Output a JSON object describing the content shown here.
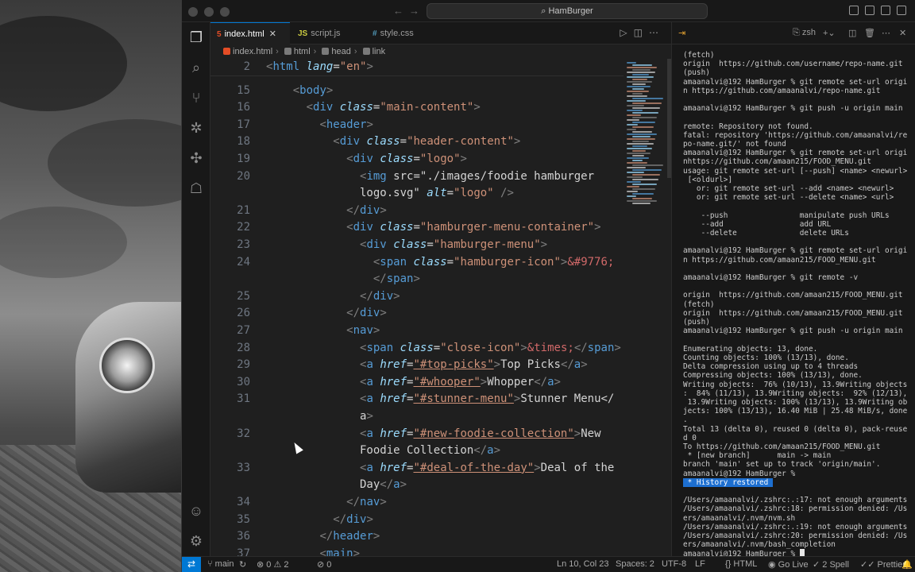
{
  "app": {
    "search_label": "HamBurger"
  },
  "tabs": [
    {
      "label": "index.html",
      "icon": "html-file-icon",
      "active": true
    },
    {
      "label": "script.js",
      "icon": "js-file-icon",
      "active": false
    },
    {
      "label": "style.css",
      "icon": "css-file-icon",
      "active": false
    }
  ],
  "breadcrumb": [
    "index.html",
    "html",
    "head",
    "link"
  ],
  "code": {
    "sticky_line": {
      "num": "2",
      "text": "<html lang=\"en\">"
    },
    "lines": [
      {
        "num": "15",
        "text": "    <body>"
      },
      {
        "num": "16",
        "text": "      <div class=\"main-content\">"
      },
      {
        "num": "17",
        "text": "        <header>"
      },
      {
        "num": "18",
        "text": "          <div class=\"header-content\">"
      },
      {
        "num": "19",
        "text": "            <div class=\"logo\">"
      },
      {
        "num": "20",
        "text": "              <img src=\"./images/foodie hamburger"
      },
      {
        "num": "",
        "text": "              logo.svg\" alt=\"logo\" />"
      },
      {
        "num": "21",
        "text": "            </div>"
      },
      {
        "num": "22",
        "text": "            <div class=\"hamburger-menu-container\">"
      },
      {
        "num": "23",
        "text": "              <div class=\"hamburger-menu\">"
      },
      {
        "num": "24",
        "text": "                <span class=\"hamburger-icon\">&#9776;"
      },
      {
        "num": "",
        "text": "                </span>"
      },
      {
        "num": "25",
        "text": "              </div>"
      },
      {
        "num": "26",
        "text": "            </div>"
      },
      {
        "num": "27",
        "text": "            <nav>"
      },
      {
        "num": "28",
        "text": "              <span class=\"close-icon\">&times;</span>"
      },
      {
        "num": "29",
        "text": "              <a href=\"#top-picks\">Top Picks</a>"
      },
      {
        "num": "30",
        "text": "              <a href=\"#whooper\">Whopper</a>"
      },
      {
        "num": "31",
        "text": "              <a href=\"#stunner-menu\">Stunner Menu</"
      },
      {
        "num": "",
        "text": "              a>"
      },
      {
        "num": "32",
        "text": "              <a href=\"#new-foodie-collection\">New"
      },
      {
        "num": "",
        "text": "              Foodie Collection</a>"
      },
      {
        "num": "33",
        "text": "              <a href=\"#deal-of-the-day\">Deal of the"
      },
      {
        "num": "",
        "text": "              Day</a>"
      },
      {
        "num": "34",
        "text": "            </nav>"
      },
      {
        "num": "35",
        "text": "          </div>"
      },
      {
        "num": "36",
        "text": "        </header>"
      },
      {
        "num": "37",
        "text": "        <main>"
      }
    ]
  },
  "terminal": {
    "shell": "zsh",
    "lines": [
      "(fetch)",
      "origin  https://github.com/username/repo-name.git",
      "(push)",
      "amaanalvi@192 HamBurger % git remote set-url origi",
      "n https://github.com/amaanalvi/repo-name.git",
      "",
      "amaanalvi@192 HamBurger % git push -u origin main",
      "",
      "remote: Repository not found.",
      "fatal: repository 'https://github.com/amaanalvi/re",
      "po-name.git/' not found",
      "amaanalvi@192 HamBurger % git remote set-url origi",
      "nhttps://github.com/amaan215/FOOD_MENU.git",
      "usage: git remote set-url [--push] <name> <newurl>",
      " [<oldurl>]",
      "   or: git remote set-url --add <name> <newurl>",
      "   or: git remote set-url --delete <name> <url>",
      "",
      "    --push                manipulate push URLs",
      "    --add                 add URL",
      "    --delete              delete URLs",
      "",
      "amaanalvi@192 HamBurger % git remote set-url origi",
      "n https://github.com/amaan215/FOOD_MENU.git",
      "",
      "amaanalvi@192 HamBurger % git remote -v",
      "",
      "origin  https://github.com/amaan215/FOOD_MENU.git",
      "(fetch)",
      "origin  https://github.com/amaan215/FOOD_MENU.git",
      "(push)",
      "amaanalvi@192 HamBurger % git push -u origin main",
      "",
      "Enumerating objects: 13, done.",
      "Counting objects: 100% (13/13), done.",
      "Delta compression using up to 4 threads",
      "Compressing objects: 100% (13/13), done.",
      "Writing objects:  76% (10/13), 13.9Writing objects",
      ":  84% (11/13), 13.9Writing objects:  92% (12/13),",
      " 13.9Writing objects: 100% (13/13), 13.9Writing ob",
      "jects: 100% (13/13), 16.40 MiB | 25.48 MiB/s, done",
      ".",
      "Total 13 (delta 0), reused 0 (delta 0), pack-reuse",
      "d 0",
      "To https://github.com/amaan215/FOOD_MENU.git",
      " * [new branch]      main -> main",
      "branch 'main' set up to track 'origin/main'.",
      "amaanalvi@192 HamBurger %"
    ],
    "history_label": "History restored",
    "after_lines": [
      "",
      "/Users/amaanalvi/.zshrc:.:17: not enough arguments",
      "/Users/amaanalvi/.zshrc:18: permission denied: /Us",
      "ers/amaanalvi/.nvm/nvm.sh",
      "/Users/amaanalvi/.zshrc:.:19: not enough arguments",
      "/Users/amaanalvi/.zshrc:20: permission denied: /Us",
      "ers/amaanalvi/.nvm/bash_completion",
      "amaanalvi@192 HamBurger % "
    ]
  },
  "status": {
    "branch": "main",
    "errors": "0",
    "warnings": "2",
    "ports": "0",
    "position": "Ln 10, Col 23",
    "spaces": "Spaces: 2",
    "encoding": "UTF-8",
    "eol": "LF",
    "language": "HTML",
    "golive": "Go Live",
    "spell": "2 Spell",
    "prettier": "Prettier"
  }
}
